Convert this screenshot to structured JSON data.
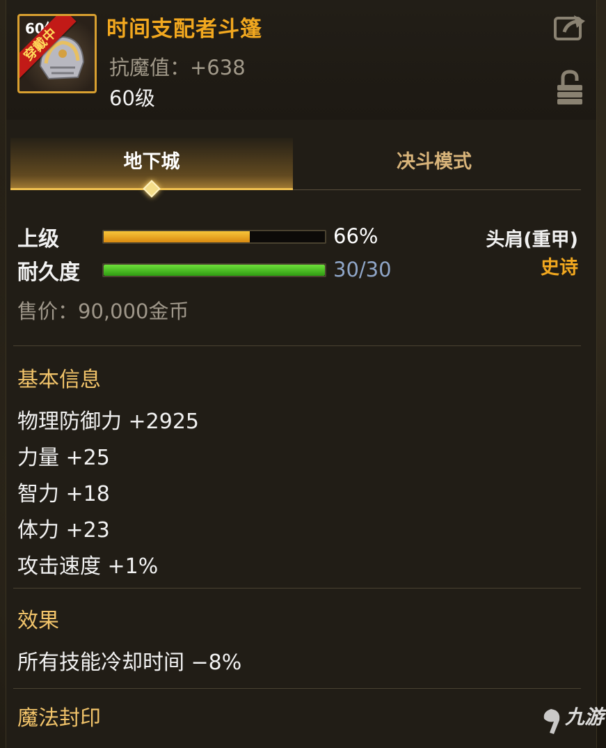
{
  "item": {
    "name": "时间支配者斗篷",
    "resist": "抗魔值：+638",
    "level": "60级",
    "equipped_ribbon": "穿戴中",
    "icon_mini_level": "60级"
  },
  "header_icons": [
    "share-icon",
    "lock-icon"
  ],
  "tabs": [
    {
      "label": "地下城",
      "active": true
    },
    {
      "label": "决斗模式",
      "active": false
    }
  ],
  "grade": {
    "label": "上级",
    "percent_text": "66%",
    "fill": 0.66
  },
  "durability": {
    "label": "耐久度",
    "value": "30/30",
    "fill": 1.0
  },
  "slot": "头肩(重甲)",
  "rarity": "史诗",
  "price": "售价：90,000金币",
  "basic_info": {
    "title": "基本信息",
    "stats": [
      "物理防御力 +2925",
      "力量 +25",
      "智力 +18",
      "体力 +23",
      "攻击速度 +1%"
    ]
  },
  "effect": {
    "title": "效果",
    "lines": [
      "所有技能冷却时间 −8%"
    ]
  },
  "seal": {
    "title": "魔法封印"
  },
  "watermark": "九游",
  "colors": {
    "name": "#f2a81f",
    "section_title": "#f2c46a",
    "grade_bar": "#e8a020",
    "durability_bar": "#4cc026",
    "durability_text": "#8fa6c8",
    "panel_bg": "#211d16"
  }
}
